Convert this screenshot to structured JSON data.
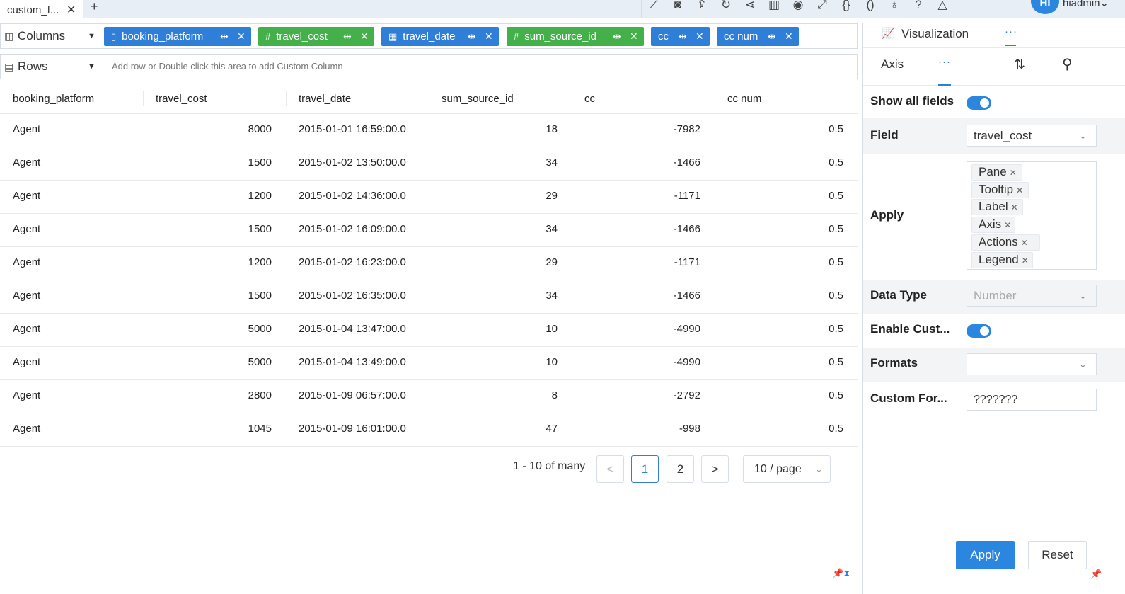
{
  "tab": {
    "title": "custom_f...",
    "close": "✕",
    "add": "+"
  },
  "toolbar": {
    "icons": [
      "chart-icon",
      "camera-icon",
      "export-icon",
      "refresh-icon",
      "share-icon",
      "layout-icon",
      "eye-icon",
      "expand-icon",
      "braces-icon",
      "code-icon",
      "bulb-icon",
      "help-icon",
      "bell-icon"
    ]
  },
  "user": {
    "initials": "HI",
    "name": "hiadmin"
  },
  "columns_shelf": {
    "label": "Columns",
    "pills": [
      {
        "name": "booking_platform",
        "color": "#2f7ed8",
        "icon": "▯"
      },
      {
        "name": "travel_cost",
        "color": "#43b04a",
        "icon": "#"
      },
      {
        "name": "travel_date",
        "color": "#2f7ed8",
        "icon": "▦"
      },
      {
        "name": "sum_source_id",
        "color": "#43b04a",
        "icon": "#"
      },
      {
        "name": "cc",
        "color": "#2f7ed8",
        "icon": ""
      },
      {
        "name": "cc num",
        "color": "#2f7ed8",
        "icon": ""
      }
    ]
  },
  "rows_shelf": {
    "label": "Rows",
    "placeholder": "Add row or Double click this area to add Custom Column"
  },
  "table": {
    "headers": [
      "booking_platform",
      "travel_cost",
      "travel_date",
      "sum_source_id",
      "cc",
      "cc num"
    ],
    "rows": [
      [
        "Agent",
        "8000",
        "2015-01-01 16:59:00.0",
        "18",
        "-7982",
        "0.5"
      ],
      [
        "Agent",
        "1500",
        "2015-01-02 13:50:00.0",
        "34",
        "-1466",
        "0.5"
      ],
      [
        "Agent",
        "1200",
        "2015-01-02 14:36:00.0",
        "29",
        "-1171",
        "0.5"
      ],
      [
        "Agent",
        "1500",
        "2015-01-02 16:09:00.0",
        "34",
        "-1466",
        "0.5"
      ],
      [
        "Agent",
        "1200",
        "2015-01-02 16:23:00.0",
        "29",
        "-1171",
        "0.5"
      ],
      [
        "Agent",
        "1500",
        "2015-01-02 16:35:00.0",
        "34",
        "-1466",
        "0.5"
      ],
      [
        "Agent",
        "5000",
        "2015-01-04 13:47:00.0",
        "10",
        "-4990",
        "0.5"
      ],
      [
        "Agent",
        "5000",
        "2015-01-04 13:49:00.0",
        "10",
        "-4990",
        "0.5"
      ],
      [
        "Agent",
        "2800",
        "2015-01-09 06:57:00.0",
        "8",
        "-2792",
        "0.5"
      ],
      [
        "Agent",
        "1045",
        "2015-01-09 16:01:00.0",
        "47",
        "-998",
        "0.5"
      ]
    ]
  },
  "pager": {
    "total": "1 - 10 of many",
    "prev": "<",
    "next": ">",
    "pages": [
      "1",
      "2"
    ],
    "current_page": "1",
    "page_size": "10 / page"
  },
  "panel": {
    "tab_visualization": "Visualization",
    "tab_more": "···",
    "subtab_axis": "Axis",
    "subtab_more": "···",
    "show_all_fields_label": "Show all fields",
    "show_all_fields_on": true,
    "field_label": "Field",
    "field_value": "travel_cost",
    "apply_label": "Apply",
    "apply_tags": [
      "Pane",
      "Tooltip",
      "Label",
      "Axis",
      "Actions",
      "Legend"
    ],
    "data_type_label": "Data Type",
    "data_type_value": "Number",
    "enable_custom_label": "Enable Cust...",
    "enable_custom_on": true,
    "formats_label": "Formats",
    "formats_value": "",
    "custom_format_label": "Custom For...",
    "custom_format_value": "???????",
    "apply_button": "Apply",
    "reset_button": "Reset"
  },
  "colors": {
    "accent": "#2b86e0",
    "pill_blue": "#2f7ed8",
    "pill_green": "#43b04a"
  }
}
